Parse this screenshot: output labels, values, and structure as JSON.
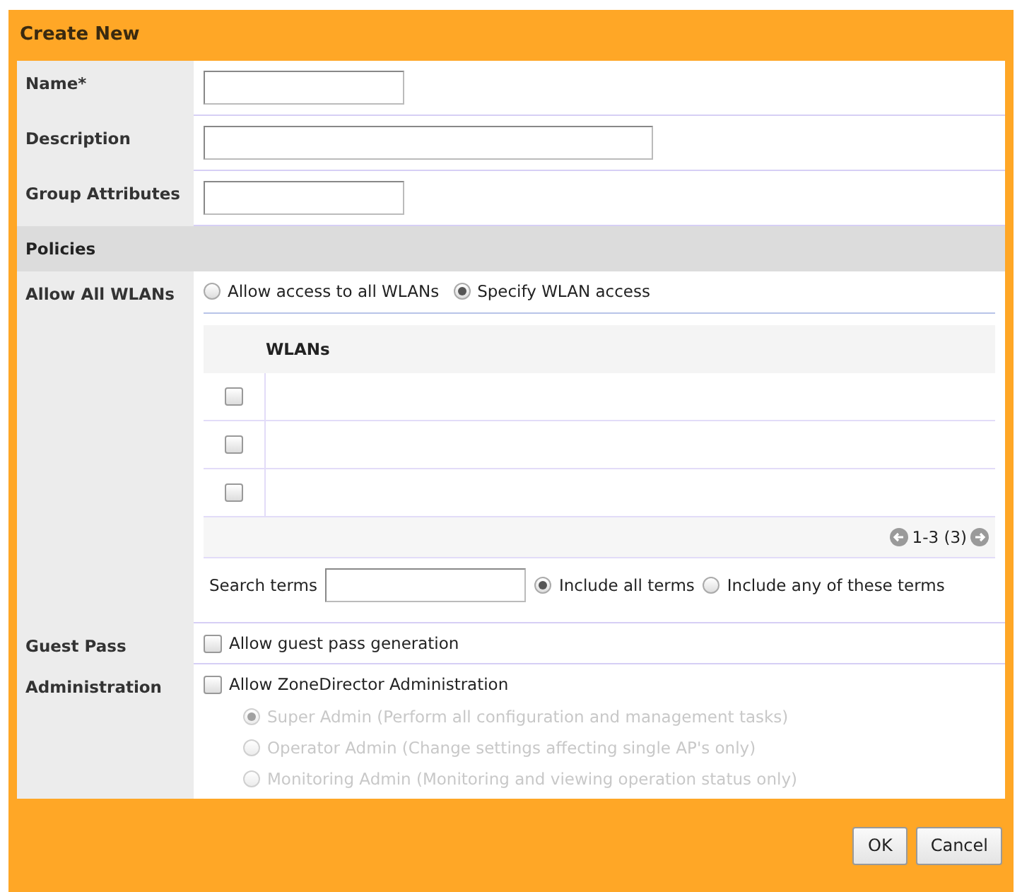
{
  "dialog": {
    "title": "Create New"
  },
  "fields": [
    {
      "label": "Name*",
      "kind": "short"
    },
    {
      "label": "Description",
      "kind": "long"
    },
    {
      "label": "Group Attributes",
      "kind": "short"
    }
  ],
  "policies": {
    "heading": "Policies"
  },
  "wlan_access": {
    "label": "Allow All WLANs",
    "options": [
      {
        "label": "Allow access to all WLANs",
        "selected": false
      },
      {
        "label": "Specify WLAN access",
        "selected": true
      }
    ],
    "table": {
      "columns": [
        "WLANs"
      ],
      "rows": [
        {
          "checked": false
        },
        {
          "checked": false
        },
        {
          "checked": false
        }
      ],
      "pager": "1-3 (3)",
      "search": {
        "label": "Search terms",
        "options": [
          {
            "label": "Include all terms",
            "selected": true
          },
          {
            "label": "Include any of these terms",
            "selected": false
          }
        ]
      }
    }
  },
  "guest_pass": {
    "label": "Guest Pass",
    "option": {
      "label": "Allow guest pass generation",
      "checked": false
    }
  },
  "administration": {
    "label": "Administration",
    "option": {
      "label": "Allow ZoneDirector Administration",
      "checked": false
    },
    "roles": [
      {
        "label": "Super Admin (Perform all configuration and management tasks)",
        "selected": true,
        "disabled": true
      },
      {
        "label": "Operator Admin (Change settings affecting single AP's only)",
        "selected": false,
        "disabled": true
      },
      {
        "label": "Monitoring Admin (Monitoring and viewing operation status only)",
        "selected": false,
        "disabled": true
      }
    ]
  },
  "buttons": [
    "OK",
    "Cancel"
  ]
}
